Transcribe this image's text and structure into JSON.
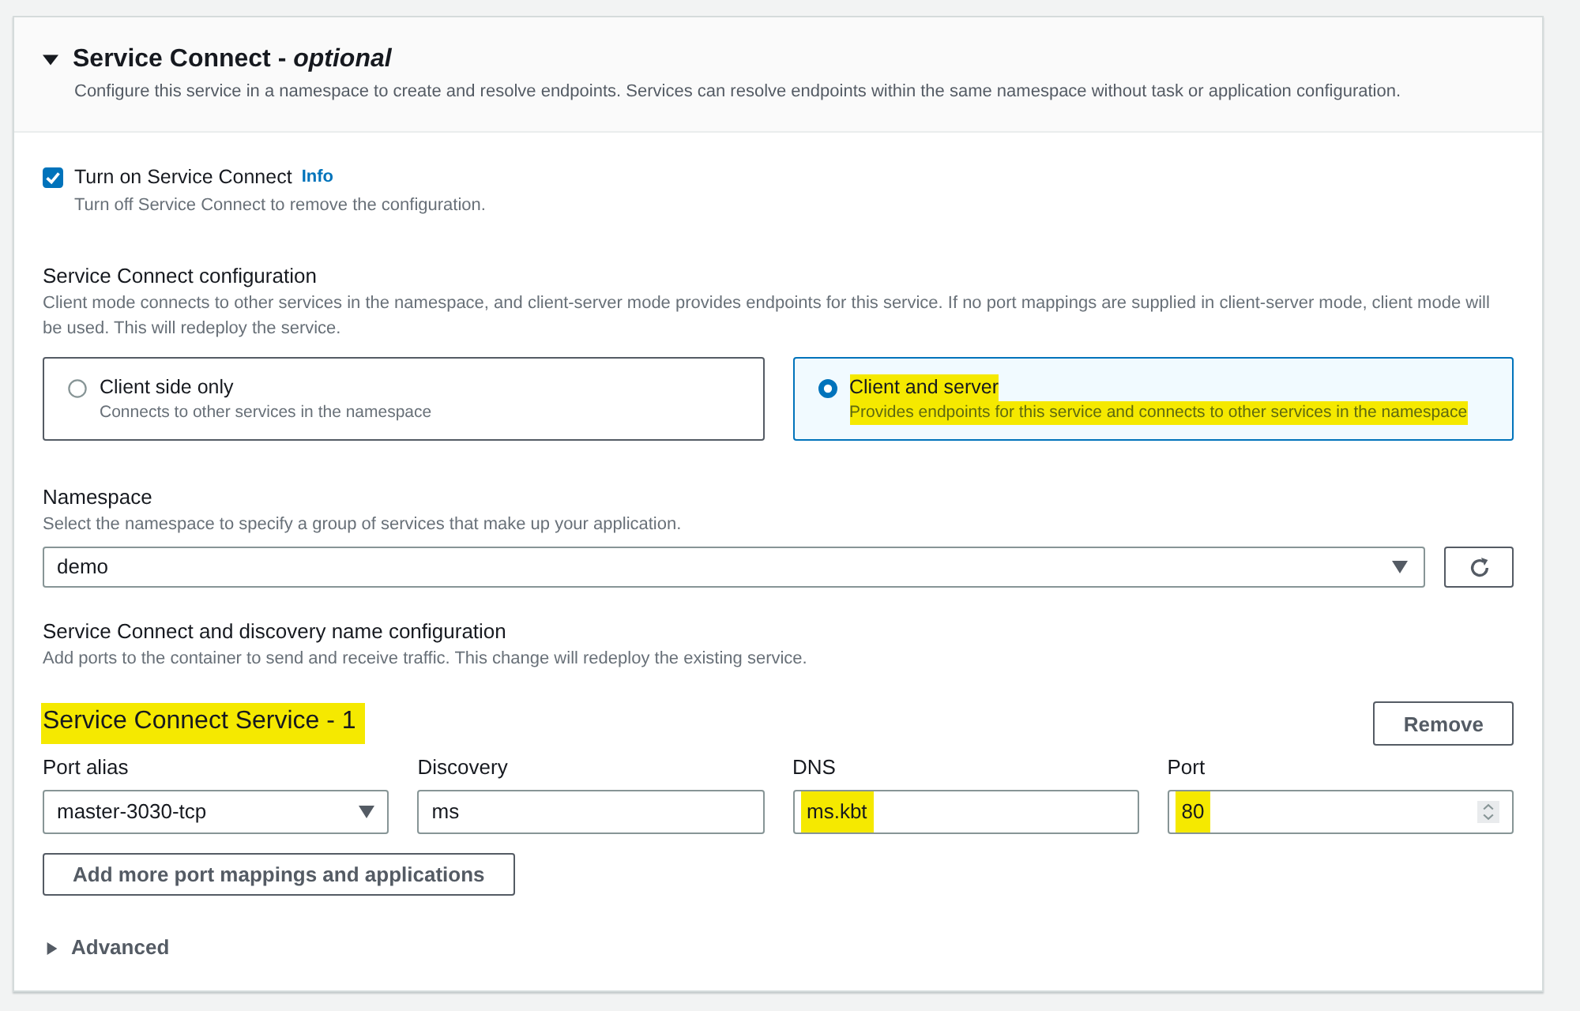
{
  "section": {
    "title": "Service Connect - *optional*",
    "expanded": true,
    "description": "Configure this service in a namespace to create and resolve endpoints. Services can resolve endpoints within the same namespace without task or application configuration."
  },
  "toggle": {
    "label": "Turn on Service Connect",
    "info_link": "Info",
    "checked": true,
    "description": "Turn off Service Connect to remove the configuration."
  },
  "configuration": {
    "label": "Service Connect configuration",
    "description": "Client mode connects to other services in the namespace, and client-server mode provides endpoints for this service. If no port mappings are supplied in client-server mode, client mode will be used. This will redeploy the service.",
    "options": [
      {
        "label": "Client side only",
        "description": "Connects to other services in the namespace",
        "selected": false,
        "highlighted": false
      },
      {
        "label": "Client and server",
        "description": "Provides endpoints for this service and connects to other services in the namespace",
        "selected": true,
        "highlighted": true
      }
    ]
  },
  "namespace": {
    "label": "Namespace",
    "description": "Select the namespace to specify a group of services that make up your application.",
    "value": "demo"
  },
  "discovery": {
    "label": "Service Connect and discovery name configuration",
    "description": "Add ports to the container to send and receive traffic. This change will redeploy the existing service."
  },
  "service": {
    "heading": "Service Connect Service - 1",
    "highlighted": true,
    "remove_button": "Remove",
    "fields": [
      {
        "kind": "select",
        "label": "Port alias",
        "value": "master-3030-tcp",
        "highlighted": false
      },
      {
        "kind": "text",
        "label": "Discovery",
        "value": "ms",
        "highlighted": false
      },
      {
        "kind": "text",
        "label": "DNS",
        "value": "ms.kbt",
        "highlighted": true
      },
      {
        "kind": "number",
        "label": "Port",
        "value": "80",
        "highlighted": true
      }
    ]
  },
  "add_button": "Add more port mappings and applications",
  "advanced": {
    "label": "Advanced",
    "expanded": false
  }
}
